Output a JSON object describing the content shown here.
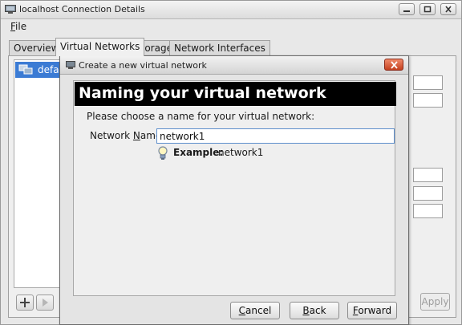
{
  "window": {
    "title": "localhost Connection Details",
    "menu": {
      "file_accel": "F",
      "file_rest": "ile"
    }
  },
  "tabs": [
    {
      "label": "Overview"
    },
    {
      "label": "Virtual Networks"
    },
    {
      "label": "Storage"
    },
    {
      "label": "Network Interfaces"
    }
  ],
  "network_list": {
    "items": [
      {
        "label": "defau"
      }
    ]
  },
  "apply_button": {
    "label": "Apply"
  },
  "dialog": {
    "title": "Create a new virtual network",
    "heading": "Naming your virtual network",
    "prompt": "Please choose a name for your virtual network:",
    "name_label_before": "Network ",
    "name_label_accel": "N",
    "name_label_after": "ame:",
    "name_value": "network1",
    "example_key": "Example:",
    "example_value": "network1",
    "buttons": {
      "cancel_accel": "C",
      "cancel_rest": "ancel",
      "back_accel": "B",
      "back_rest": "ack",
      "forward_accel": "F",
      "forward_rest": "orward"
    }
  },
  "colors": {
    "selection": "#3b7bd4",
    "banner_bg": "#000000",
    "banner_text": "#ffffff",
    "close_button": "#c4411f",
    "input_focus_border": "#5e8fcc"
  }
}
